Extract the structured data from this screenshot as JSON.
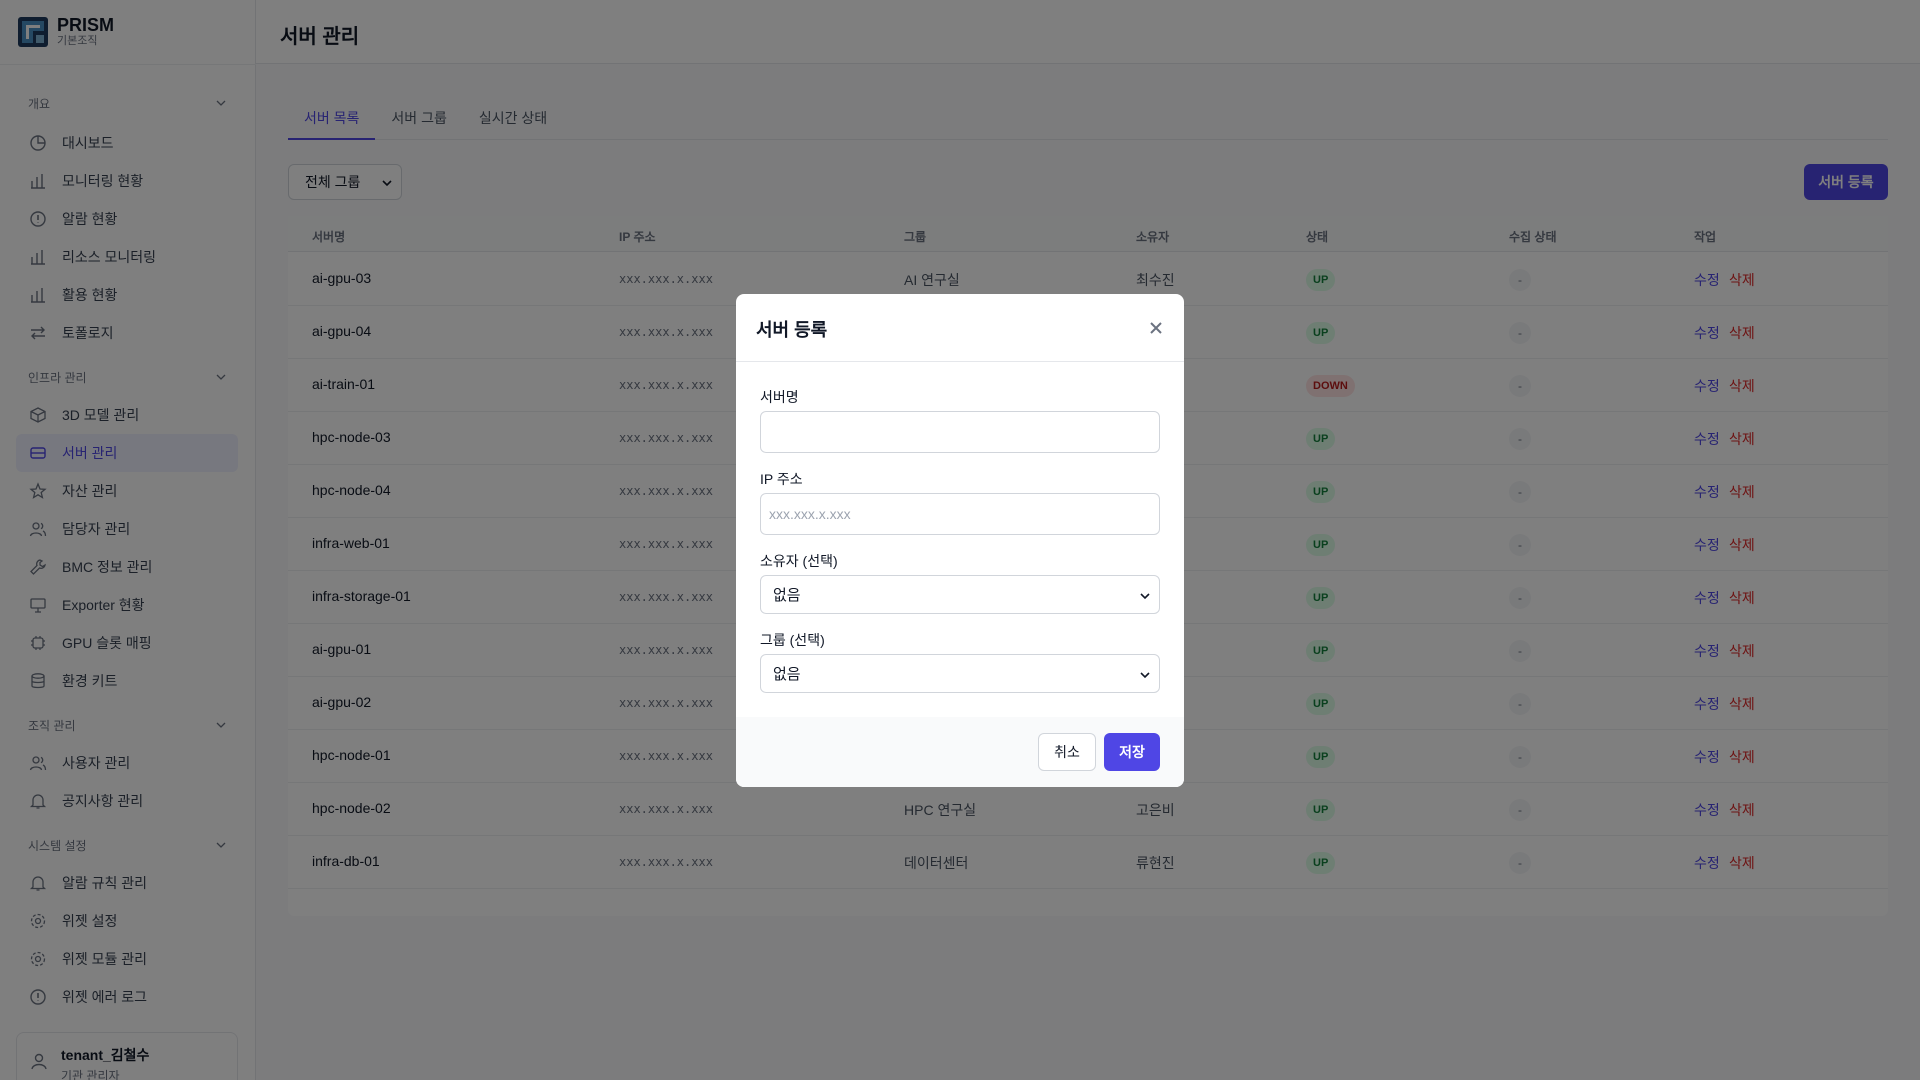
{
  "app": {
    "name": "PRISM",
    "org": "기본조직"
  },
  "page": {
    "title": "서버 관리"
  },
  "sidebar": {
    "sections": [
      {
        "label": "개요",
        "items": [
          {
            "label": "대시보드",
            "icon": "pie-chart-icon"
          },
          {
            "label": "모니터링 현황",
            "icon": "bar-chart-icon"
          },
          {
            "label": "알람 현황",
            "icon": "alert-circle-icon"
          },
          {
            "label": "리소스 모니터링",
            "icon": "bar-chart-icon"
          },
          {
            "label": "활용 현황",
            "icon": "bar-chart-icon"
          },
          {
            "label": "토폴로지",
            "icon": "arrows-icon"
          }
        ]
      },
      {
        "label": "인프라 관리",
        "items": [
          {
            "label": "3D 모델 관리",
            "icon": "cube-icon"
          },
          {
            "label": "서버 관리",
            "icon": "server-icon",
            "active": true
          },
          {
            "label": "자산 관리",
            "icon": "star-icon"
          },
          {
            "label": "담당자 관리",
            "icon": "users-icon"
          },
          {
            "label": "BMC 정보 관리",
            "icon": "wrench-icon"
          },
          {
            "label": "Exporter 현황",
            "icon": "monitor-icon"
          },
          {
            "label": "GPU 슬롯 매핑",
            "icon": "chip-icon"
          },
          {
            "label": "환경 키트",
            "icon": "database-icon"
          }
        ]
      },
      {
        "label": "조직 관리",
        "items": [
          {
            "label": "사용자 관리",
            "icon": "users-icon"
          },
          {
            "label": "공지사항 관리",
            "icon": "bell-icon"
          }
        ]
      },
      {
        "label": "시스템 설정",
        "items": [
          {
            "label": "알람 규칙 관리",
            "icon": "bell-icon"
          },
          {
            "label": "위젯 설정",
            "icon": "gear-icon"
          },
          {
            "label": "위젯 모듈 관리",
            "icon": "gear-icon"
          },
          {
            "label": "위젯 에러 로그",
            "icon": "alert-circle-icon"
          }
        ]
      }
    ]
  },
  "user": {
    "name": "tenant_김철수",
    "role": "기관 관리자"
  },
  "tabs": [
    {
      "label": "서버 목록",
      "active": true
    },
    {
      "label": "서버 그룹"
    },
    {
      "label": "실시간 상태"
    }
  ],
  "filter": {
    "group_value": "전체 그룹"
  },
  "toolbar": {
    "add_label": "서버 등록"
  },
  "table": {
    "columns": [
      "서버명",
      "IP 주소",
      "그룹",
      "소유자",
      "상태",
      "수집 상태",
      "작업"
    ],
    "edit_label": "수정",
    "delete_label": "삭제",
    "rows": [
      {
        "name": "ai-gpu-03",
        "ip": "xxx.xxx.x.xxx",
        "group": "AI 연구실",
        "owner": "최수진",
        "status": "UP",
        "collect": "-"
      },
      {
        "name": "ai-gpu-04",
        "ip": "xxx.xxx.x.xxx",
        "group": "",
        "owner": "",
        "status": "UP",
        "collect": "-"
      },
      {
        "name": "ai-train-01",
        "ip": "xxx.xxx.x.xxx",
        "group": "",
        "owner": "",
        "status": "DOWN",
        "collect": "-"
      },
      {
        "name": "hpc-node-03",
        "ip": "xxx.xxx.x.xxx",
        "group": "",
        "owner": "",
        "status": "UP",
        "collect": "-"
      },
      {
        "name": "hpc-node-04",
        "ip": "xxx.xxx.x.xxx",
        "group": "",
        "owner": "",
        "status": "UP",
        "collect": "-"
      },
      {
        "name": "infra-web-01",
        "ip": "xxx.xxx.x.xxx",
        "group": "",
        "owner": "",
        "status": "UP",
        "collect": "-"
      },
      {
        "name": "infra-storage-01",
        "ip": "xxx.xxx.x.xxx",
        "group": "",
        "owner": "",
        "status": "UP",
        "collect": "-"
      },
      {
        "name": "ai-gpu-01",
        "ip": "xxx.xxx.x.xxx",
        "group": "",
        "owner": "",
        "status": "UP",
        "collect": "-"
      },
      {
        "name": "ai-gpu-02",
        "ip": "xxx.xxx.x.xxx",
        "group": "",
        "owner": "",
        "status": "UP",
        "collect": "-"
      },
      {
        "name": "hpc-node-01",
        "ip": "xxx.xxx.x.xxx",
        "group": "",
        "owner": "",
        "status": "UP",
        "collect": "-"
      },
      {
        "name": "hpc-node-02",
        "ip": "xxx.xxx.x.xxx",
        "group": "HPC 연구실",
        "owner": "고은비",
        "status": "UP",
        "collect": "-"
      },
      {
        "name": "infra-db-01",
        "ip": "xxx.xxx.x.xxx",
        "group": "데이터센터",
        "owner": "류현진",
        "status": "UP",
        "collect": "-"
      }
    ]
  },
  "modal": {
    "title": "서버 등록",
    "name_label": "서버명",
    "name_value": "",
    "ip_label": "IP 주소",
    "ip_placeholder": "xxx.xxx.x.xxx",
    "owner_label": "소유자 (선택)",
    "owner_value": "없음",
    "group_label": "그룹 (선택)",
    "group_value": "없음",
    "cancel_label": "취소",
    "save_label": "저장"
  },
  "colors": {
    "accent": "#4f46e5",
    "up_bg": "#dcfce7",
    "up_text": "#15803d",
    "down_bg": "#fee2e2",
    "down_text": "#b91c1c",
    "delete": "#dc2626"
  }
}
